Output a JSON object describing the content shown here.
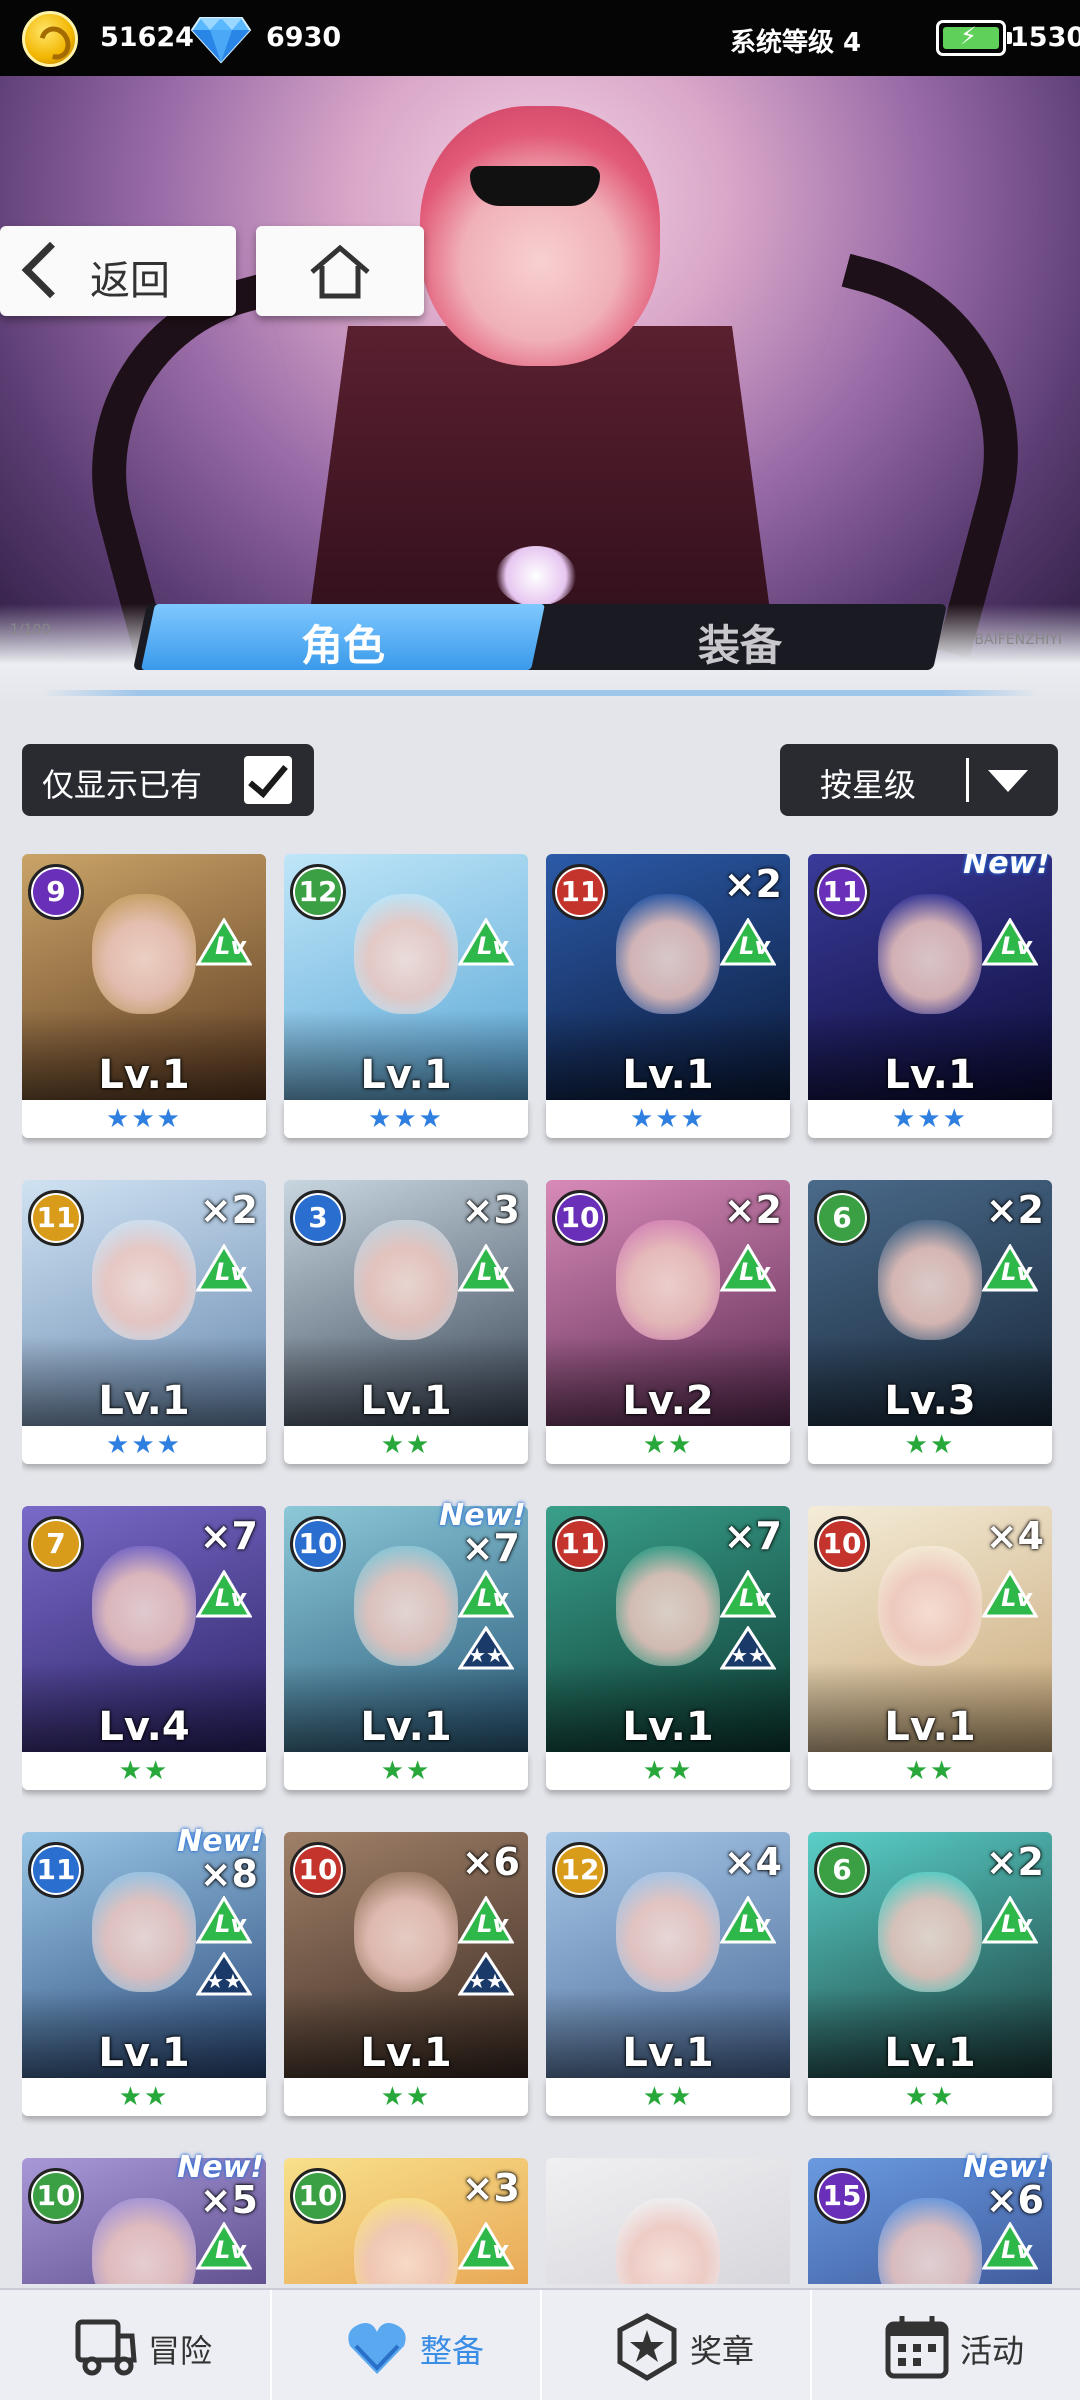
{
  "topbar": {
    "coins": "51624",
    "gems": "6930",
    "system_level": "系统等级 4",
    "energy": "1530",
    "icons": [
      "coin-icon",
      "diamond-icon",
      "battery-icon"
    ]
  },
  "hero": {
    "back_label": "返回",
    "strip_left_text": "1/100",
    "strip_right_text": "BAIFENZHIYI"
  },
  "tabs": {
    "character": "角色",
    "equipment": "装备",
    "active": "character"
  },
  "filters": {
    "owned_only_label": "仅显示已有",
    "owned_only_checked": true,
    "sort_label": "按星级"
  },
  "cards": [
    {
      "rank": "9",
      "count": "",
      "is_new": false,
      "level": "Lv.1",
      "stars": "★★★",
      "star_color": "blue",
      "badge": "#6a2fb8",
      "bg": [
        "#c9a468",
        "#5e3b22"
      ],
      "starup": false
    },
    {
      "rank": "12",
      "count": "",
      "is_new": false,
      "level": "Lv.1",
      "stars": "★★★",
      "star_color": "blue",
      "badge": "#3aa043",
      "bg": [
        "#bfe6f8",
        "#5aa6d6"
      ],
      "starup": false
    },
    {
      "rank": "11",
      "count": "×2",
      "is_new": false,
      "level": "Lv.1",
      "stars": "★★★",
      "star_color": "blue",
      "badge": "#c4332c",
      "bg": [
        "#2c5aa8",
        "#0b1a3a"
      ],
      "starup": false
    },
    {
      "rank": "11",
      "count": "",
      "is_new": true,
      "level": "Lv.1",
      "stars": "★★★",
      "star_color": "blue",
      "badge": "#6a2fb8",
      "bg": [
        "#3a3a9a",
        "#0c0c38"
      ],
      "starup": false
    },
    {
      "rank": "11",
      "count": "×2",
      "is_new": false,
      "level": "Lv.1",
      "stars": "★★★",
      "star_color": "blue",
      "badge": "#d89b1a",
      "bg": [
        "#cfe2f2",
        "#6a8ab0"
      ],
      "starup": false
    },
    {
      "rank": "3",
      "count": "×3",
      "is_new": false,
      "level": "Lv.1",
      "stars": "★★",
      "star_color": "green",
      "badge": "#2a6ed0",
      "bg": [
        "#c8d6e0",
        "#3a4656"
      ],
      "starup": false
    },
    {
      "rank": "10",
      "count": "×2",
      "is_new": false,
      "level": "Lv.2",
      "stars": "★★",
      "star_color": "green",
      "badge": "#6a2fb8",
      "bg": [
        "#d88ab8",
        "#5a2a52"
      ],
      "starup": false
    },
    {
      "rank": "6",
      "count": "×2",
      "is_new": false,
      "level": "Lv.3",
      "stars": "★★",
      "star_color": "green",
      "badge": "#3aa043",
      "bg": [
        "#4a6a8a",
        "#18283a"
      ],
      "starup": false
    },
    {
      "rank": "7",
      "count": "×7",
      "is_new": false,
      "level": "Lv.4",
      "stars": "★★",
      "star_color": "green",
      "badge": "#d89b1a",
      "bg": [
        "#7a6ac8",
        "#2a2266"
      ],
      "starup": false
    },
    {
      "rank": "10",
      "count": "×7",
      "is_new": true,
      "level": "Lv.1",
      "stars": "★★",
      "star_color": "green",
      "badge": "#2a6ed0",
      "bg": [
        "#8cc8d8",
        "#2a5a7a"
      ],
      "starup": true
    },
    {
      "rank": "11",
      "count": "×7",
      "is_new": false,
      "level": "Lv.1",
      "stars": "★★",
      "star_color": "green",
      "badge": "#c4332c",
      "bg": [
        "#3aa08a",
        "#0c3a32"
      ],
      "starup": true
    },
    {
      "rank": "10",
      "count": "×4",
      "is_new": false,
      "level": "Lv.1",
      "stars": "★★",
      "star_color": "green",
      "badge": "#c4332c",
      "bg": [
        "#f4ecd8",
        "#c8a878"
      ],
      "starup": false
    },
    {
      "rank": "11",
      "count": "×8",
      "is_new": true,
      "level": "Lv.1",
      "stars": "★★",
      "star_color": "green",
      "badge": "#2a6ed0",
      "bg": [
        "#9ac6e6",
        "#2a4a7a"
      ],
      "starup": true
    },
    {
      "rank": "10",
      "count": "×6",
      "is_new": false,
      "level": "Lv.1",
      "stars": "★★",
      "star_color": "green",
      "badge": "#c4332c",
      "bg": [
        "#a08068",
        "#3a2a22"
      ],
      "starup": true
    },
    {
      "rank": "12",
      "count": "×4",
      "is_new": false,
      "level": "Lv.1",
      "stars": "★★",
      "star_color": "green",
      "badge": "#d89b1a",
      "bg": [
        "#a8c8e8",
        "#4a6a98"
      ],
      "starup": false
    },
    {
      "rank": "6",
      "count": "×2",
      "is_new": false,
      "level": "Lv.1",
      "stars": "★★",
      "star_color": "green",
      "badge": "#3aa043",
      "bg": [
        "#5ad0c8",
        "#1a3a3a"
      ],
      "starup": false
    },
    {
      "rank": "10",
      "count": "×5",
      "is_new": true,
      "level": "",
      "stars": "",
      "star_color": "green",
      "badge": "#3aa043",
      "bg": [
        "#a898d8",
        "#3a2a6a"
      ],
      "starup": false
    },
    {
      "rank": "10",
      "count": "×3",
      "is_new": false,
      "level": "",
      "stars": "",
      "star_color": "green",
      "badge": "#3aa043",
      "bg": [
        "#f8e08a",
        "#e08a3a"
      ],
      "starup": false
    },
    {
      "rank": "",
      "count": "",
      "is_new": false,
      "level": "",
      "stars": "",
      "star_color": "green",
      "badge": "",
      "bg": [
        "#f0f0f2",
        "#c8c8d0"
      ],
      "starup": false
    },
    {
      "rank": "15",
      "count": "×6",
      "is_new": true,
      "level": "",
      "stars": "",
      "star_color": "green",
      "badge": "#6a2fb8",
      "bg": [
        "#6a9ae0",
        "#2a3a7a"
      ],
      "starup": false
    }
  ],
  "card_text": {
    "new": "New!",
    "lv_icon": "Lv"
  },
  "bottom_nav": [
    {
      "label": "冒险",
      "icon": "truck-icon"
    },
    {
      "label": "整备",
      "icon": "heart-shield-icon",
      "active": true
    },
    {
      "label": "奖章",
      "icon": "star-badge-icon"
    },
    {
      "label": "活动",
      "icon": "calendar-icon"
    }
  ]
}
